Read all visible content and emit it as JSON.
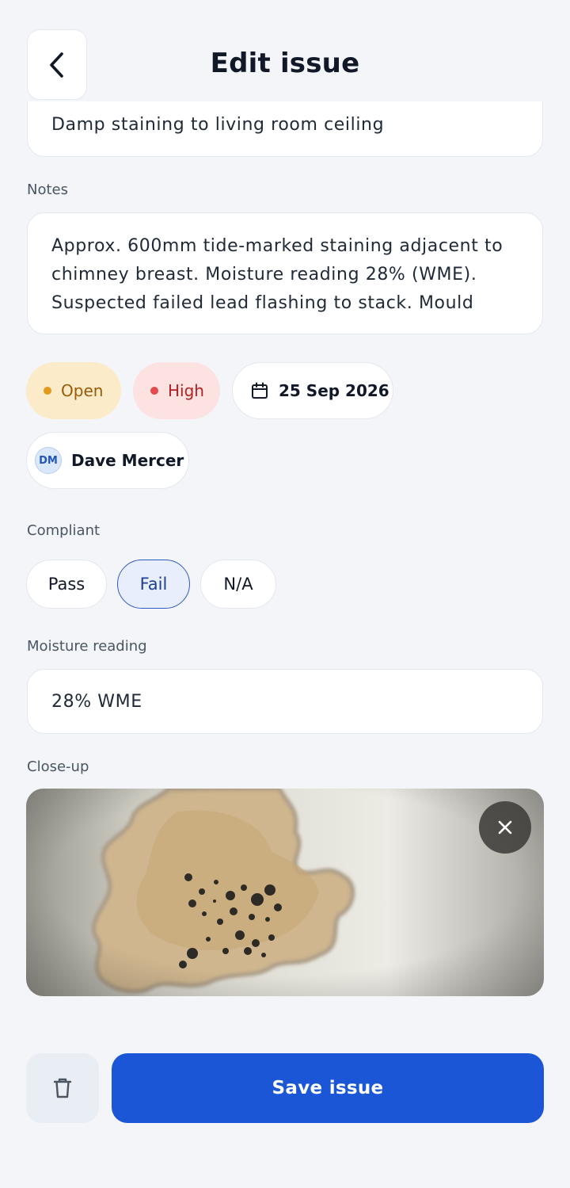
{
  "header": {
    "title": "Edit issue",
    "back_icon": "chevron-left-icon"
  },
  "issue": {
    "title_value": "Damp staining to living room ceiling",
    "notes_label": "Notes",
    "notes_value": "Approx. 600mm tide-marked staining adjacent to chimney breast. Moisture reading 28% (WME). Suspected failed lead flashing to stack. Mould"
  },
  "chips": {
    "status": "Open",
    "status_color": "#e29a1a",
    "priority": "High",
    "priority_color": "#e5484d",
    "due_date": "25 Sep 2026",
    "date_icon": "calendar-icon",
    "assignee_initials": "DM",
    "assignee_name": "Dave Mercer"
  },
  "compliant": {
    "label": "Compliant",
    "options": [
      "Pass",
      "Fail",
      "N/A"
    ],
    "selected": "Fail"
  },
  "moisture": {
    "label": "Moisture reading",
    "value": "28% WME"
  },
  "closeup": {
    "label": "Close-up",
    "remove_icon": "close-icon"
  },
  "actions": {
    "delete_icon": "trash-icon",
    "save_label": "Save issue",
    "accent": "#1a56d6"
  }
}
